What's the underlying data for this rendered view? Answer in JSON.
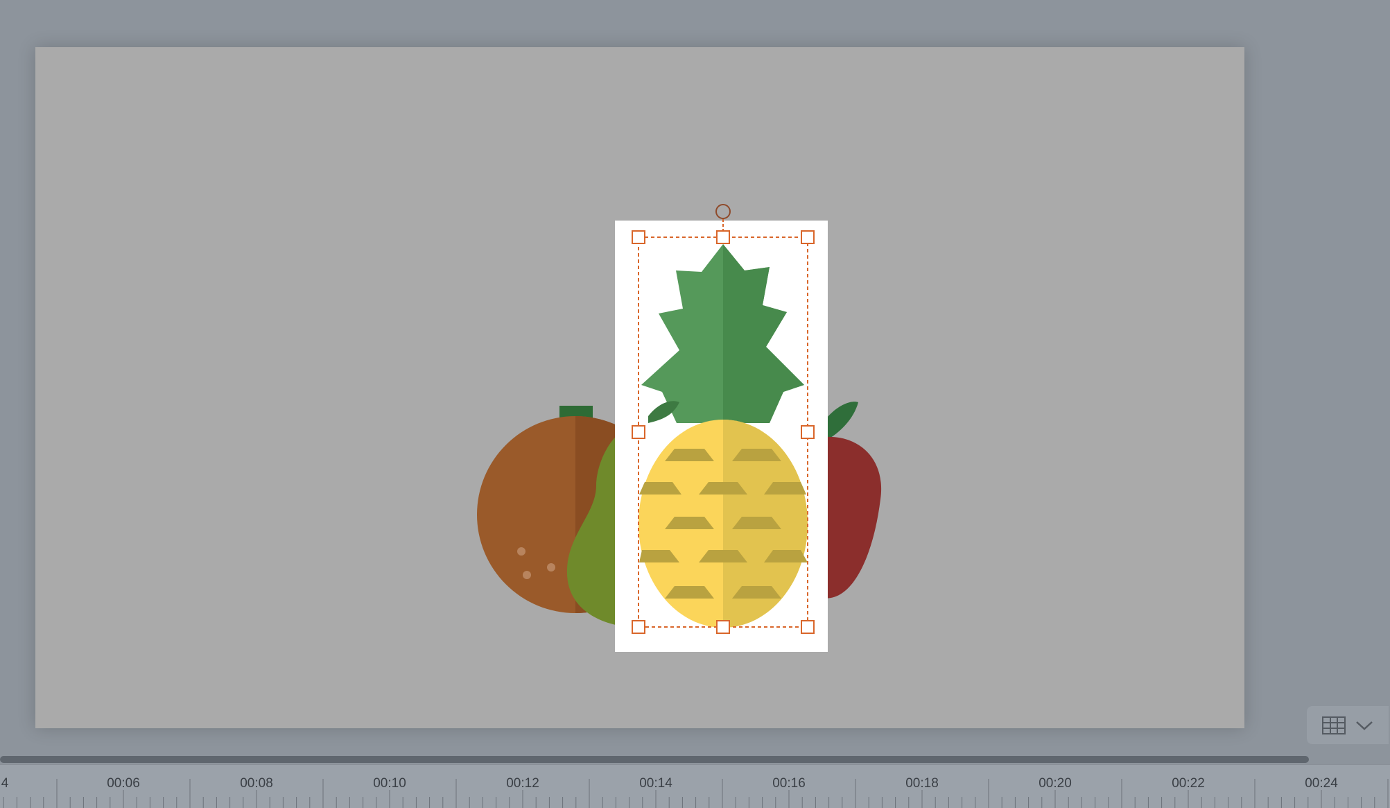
{
  "timeline": {
    "labels": [
      "4",
      "00:06",
      "00:08",
      "00:10",
      "00:12",
      "00:14",
      "00:16",
      "00:18",
      "00:20",
      "00:22",
      "00:24"
    ]
  },
  "canvas": {
    "selected_object": "pineapple",
    "objects": [
      "orange",
      "pear",
      "pineapple",
      "apple"
    ]
  },
  "controls": {
    "grid_toggle_icon": "grid-icon",
    "grid_toggle_dropdown_icon": "chevron-down-icon"
  },
  "colors": {
    "workspace": "#8d949c",
    "slide": "#aaaaaa",
    "selection": "#d9662a",
    "scrollbar_thumb": "#5f666e"
  }
}
